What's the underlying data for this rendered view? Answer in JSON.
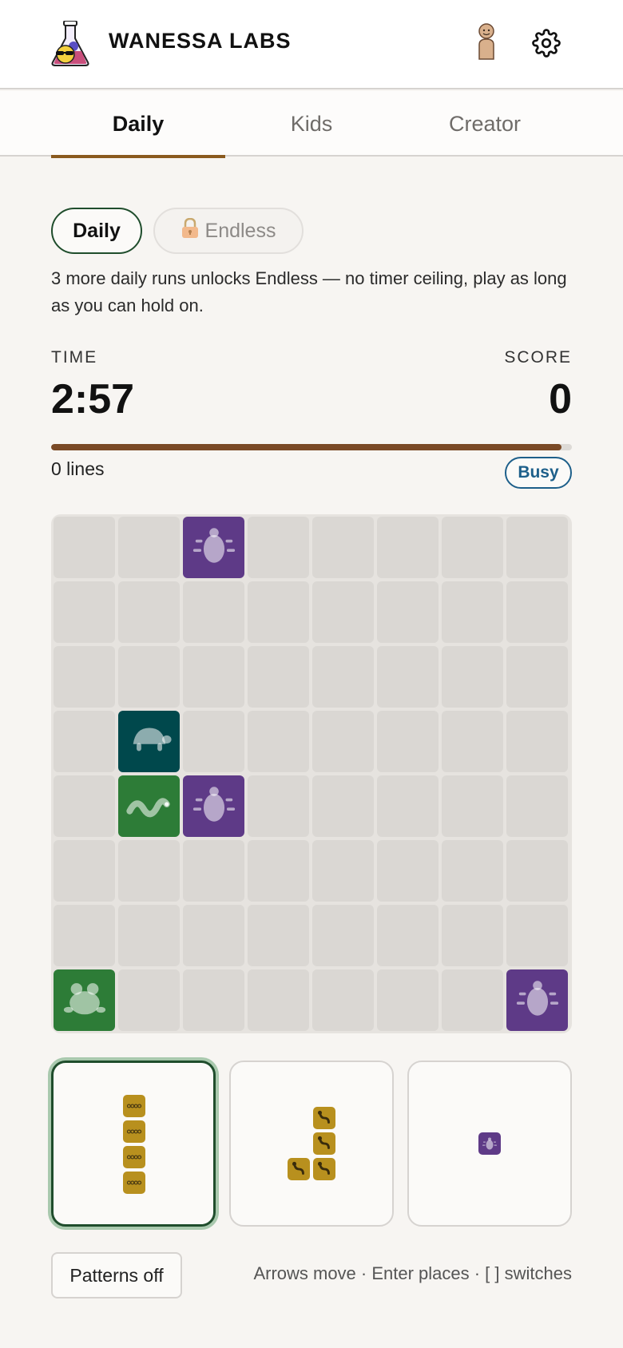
{
  "header": {
    "brand": "WANESSA LABS",
    "logo_icon": "flask-with-sunglasses-icon",
    "profile_icon": "person-figure-icon",
    "settings_icon": "gear-icon"
  },
  "tabs": [
    {
      "label": "Daily",
      "active": true
    },
    {
      "label": "Kids",
      "active": false
    },
    {
      "label": "Creator",
      "active": false
    }
  ],
  "modes": {
    "daily_label": "Daily",
    "endless_label": "Endless",
    "endless_locked": true,
    "lock_icon": "lock-icon",
    "unlock_text": "3 more daily runs unlocks Endless — no timer ceiling, play as long as you can hold on."
  },
  "stats": {
    "time_label": "TIME",
    "time_value": "2:57",
    "score_label": "SCORE",
    "score_value": "0",
    "time_remaining_fraction": 0.98,
    "lines_text": "0 lines",
    "status_badge": "Busy"
  },
  "board": {
    "rows": 8,
    "cols": 8,
    "pieces": [
      {
        "row": 0,
        "col": 2,
        "animal": "beetle",
        "color": "#5e3a87"
      },
      {
        "row": 3,
        "col": 1,
        "animal": "turtle",
        "color": "#00484c"
      },
      {
        "row": 4,
        "col": 1,
        "animal": "worm",
        "color": "#2d7c37"
      },
      {
        "row": 4,
        "col": 2,
        "animal": "beetle",
        "color": "#5e3a87"
      },
      {
        "row": 7,
        "col": 0,
        "animal": "frog",
        "color": "#2d7c37"
      },
      {
        "row": 7,
        "col": 7,
        "animal": "beetle",
        "color": "#5e3a87"
      }
    ]
  },
  "tray": [
    {
      "selected": true,
      "animal": "caterpillar",
      "color": "#b8901e",
      "cells": [
        [
          0,
          0
        ],
        [
          1,
          0
        ],
        [
          2,
          0
        ],
        [
          3,
          0
        ]
      ]
    },
    {
      "selected": false,
      "animal": "snake",
      "color": "#b8901e",
      "cells": [
        [
          0,
          1
        ],
        [
          1,
          1
        ],
        [
          2,
          0
        ],
        [
          2,
          1
        ]
      ]
    },
    {
      "selected": false,
      "animal": "beetle",
      "color": "#5e3a87",
      "cells": [
        [
          0,
          0
        ]
      ]
    }
  ],
  "footer": {
    "patterns_label": "Patterns off",
    "hint": "Arrows move · Enter places · [ ] switches"
  }
}
